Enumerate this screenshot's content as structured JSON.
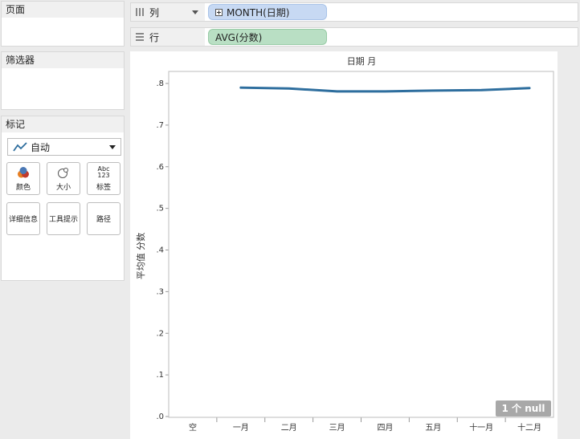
{
  "panels": {
    "pages": {
      "title": "页面"
    },
    "filters": {
      "title": "筛选器"
    },
    "marks": {
      "title": "标记",
      "mark_type": "自动",
      "buttons": {
        "color": "颜色",
        "size": "大小",
        "label": "标签",
        "label_icon_top": "Abc",
        "label_icon_bottom": "123",
        "detail": "详细信息",
        "tooltip": "工具提示",
        "path": "路径"
      }
    }
  },
  "shelves": {
    "columns": {
      "label": "列",
      "pill": "MONTH(日期)"
    },
    "rows": {
      "label": "行",
      "pill": "AVG(分数)"
    }
  },
  "null_indicator": "1 个 null",
  "colors": {
    "line": "#2e6e9e",
    "dimension_pill": "#c7d9f3",
    "measure_pill": "#b9dfc4"
  },
  "chart_data": {
    "type": "line",
    "title": "日期 月",
    "ylabel": "平均值 分数",
    "categories": [
      "空",
      "一月",
      "二月",
      "三月",
      "四月",
      "五月",
      "十一月",
      "十二月"
    ],
    "series": [
      {
        "values": [
          null,
          0.79,
          0.788,
          0.781,
          0.781,
          0.783,
          0.784,
          0.789
        ]
      }
    ],
    "ylim": [
      0,
      0.8
    ],
    "yticks": [
      0,
      0.1,
      0.2,
      0.3,
      0.4,
      0.5,
      0.6,
      0.7,
      0.8
    ],
    "ytick_labels": [
      ".0",
      ".1",
      ".2",
      ".3",
      ".4",
      ".5",
      ".6",
      ".7",
      ".8"
    ],
    "grid": false
  }
}
